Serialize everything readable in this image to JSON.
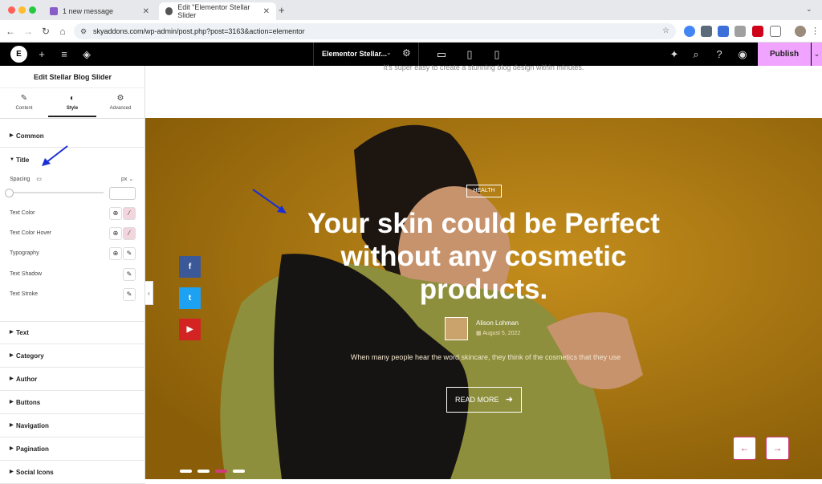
{
  "browser": {
    "tabs": [
      {
        "label": "1 new message"
      },
      {
        "label": "Edit \"Elementor Stellar Slider"
      }
    ],
    "url": "skyaddons.com/wp-admin/post.php?post=3163&action=elementor"
  },
  "editor": {
    "document_title": "Elementor Stellar...",
    "publish_label": "Publish"
  },
  "panel": {
    "title": "Edit Stellar Blog Slider",
    "tabs": [
      {
        "label": "Content"
      },
      {
        "label": "Style"
      },
      {
        "label": "Advanced"
      }
    ],
    "common": "Common",
    "title_section": "Title",
    "controls": {
      "spacing": "Spacing",
      "unit": "px",
      "text_color": "Text Color",
      "text_color_hover": "Text Color Hover",
      "typography": "Typography",
      "text_shadow": "Text Shadow",
      "text_stroke": "Text Stroke"
    },
    "sections": [
      "Text",
      "Category",
      "Author",
      "Buttons",
      "Navigation",
      "Pagination",
      "Social Icons"
    ]
  },
  "canvas": {
    "intro": "It's super easy to create a stunning blog design within minutes.",
    "slide": {
      "category": "HEALTH",
      "title": "Your skin could be Perfect without any cosmetic products.",
      "author": "Alison Lohman",
      "date": "August 5, 2022",
      "excerpt": "When many people hear the word skincare, they think of the cosmetics that they use",
      "read_more": "READ MORE"
    },
    "social": [
      {
        "label": "f",
        "color": "#3b5998"
      },
      {
        "label": "t",
        "color": "#1da1f2"
      },
      {
        "label": "▶",
        "color": "#d32323"
      }
    ],
    "pagination": {
      "active_index": 2,
      "count": 4
    }
  },
  "colors": {
    "accent": "#d13b7a",
    "publish": "#f0a3ff",
    "hero_bg": "#b07d10"
  }
}
